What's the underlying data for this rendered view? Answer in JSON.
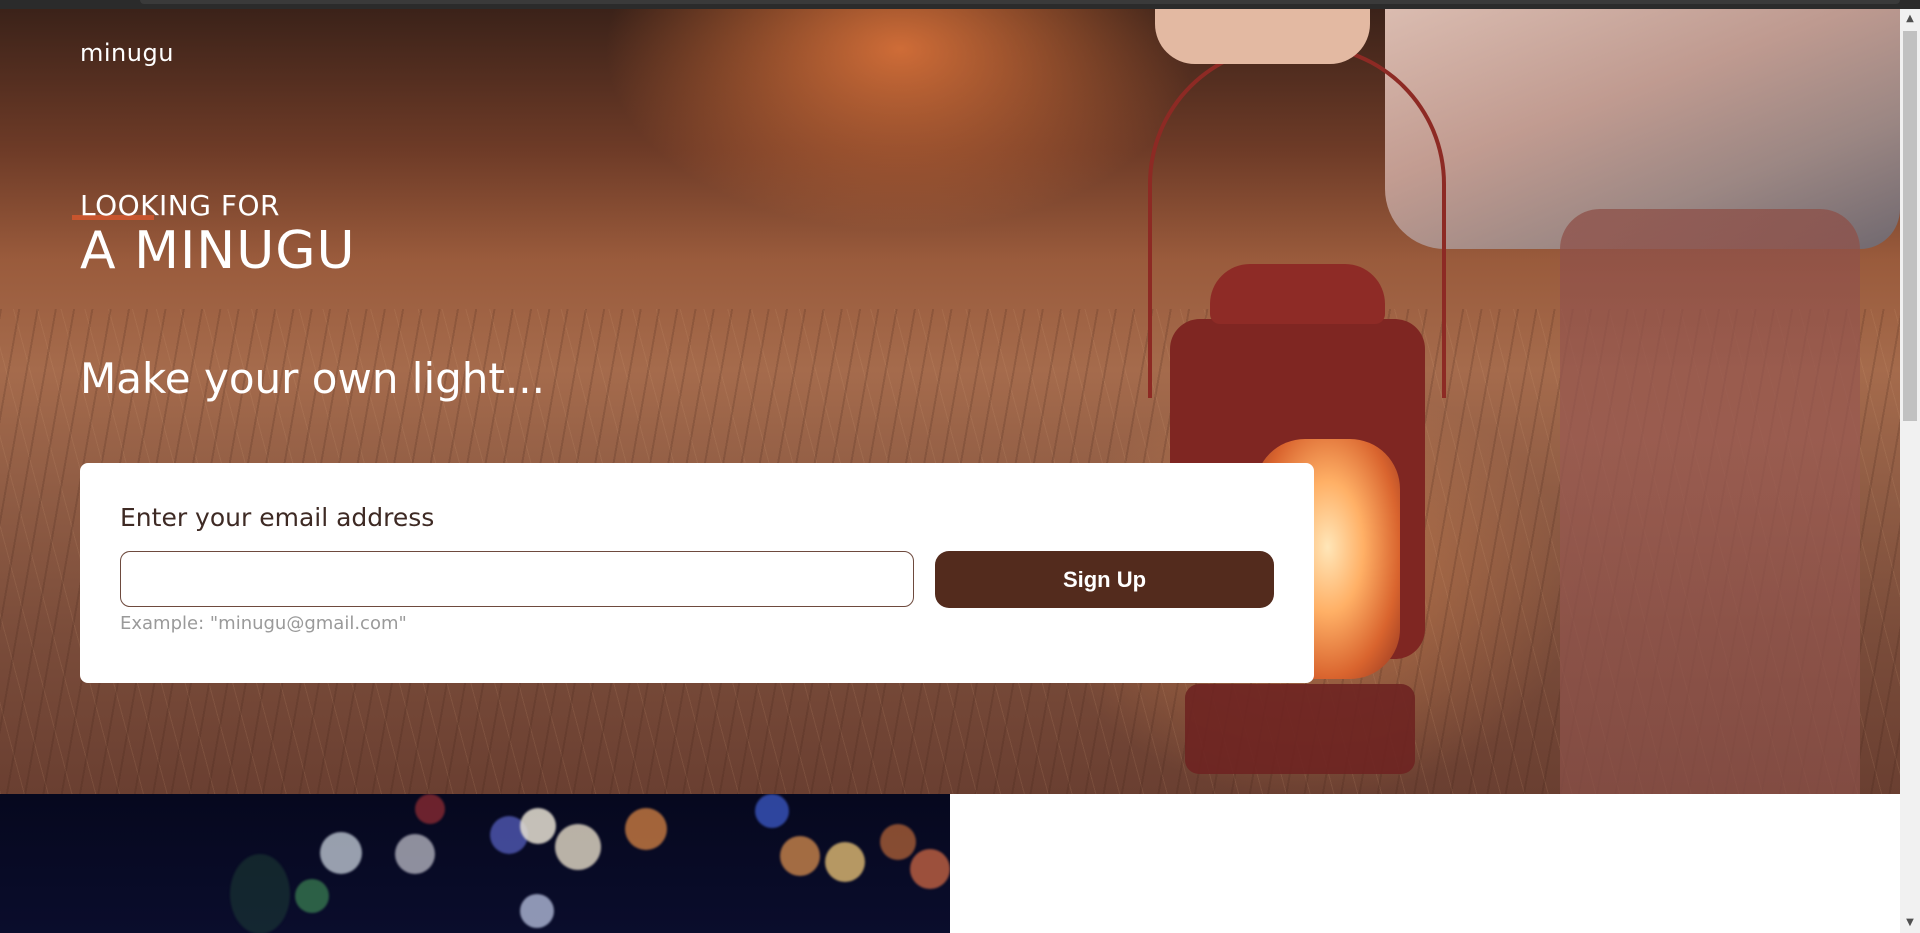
{
  "brand": {
    "name": "minugu"
  },
  "hero": {
    "kicker": "LOOKING FOR",
    "headline": "A MINUGU",
    "tagline": "Make your own light...",
    "accent_color": "#c8552e"
  },
  "signup": {
    "label": "Enter your email address",
    "input_value": "",
    "input_placeholder": "",
    "button_label": "Sign Up",
    "hint": "Example: \"minugu@gmail.com\"",
    "button_color": "#532b1d"
  },
  "scrollbar": {
    "up_icon": "triangle-up",
    "down_icon": "triangle-down"
  }
}
